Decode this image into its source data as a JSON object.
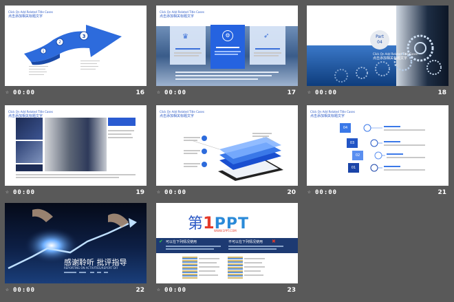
{
  "slides": [
    {
      "number": "16",
      "time": "00:00",
      "header_en": "Click On Add Related Title Cases",
      "header_cn": "点击添加相关标题文字",
      "circles": [
        "1",
        "2",
        "3"
      ]
    },
    {
      "number": "17",
      "time": "00:00",
      "header_en": "Click On Add Related Title Cases",
      "header_cn": "点击添加相关标题文字"
    },
    {
      "number": "18",
      "time": "00:00",
      "part_label": "Part",
      "part_num": "04",
      "header_en": "Click On Add Related Title Cases",
      "header_cn": "点击添加相关标题文字"
    },
    {
      "number": "19",
      "time": "00:00",
      "header_en": "Click On Add Related Title Cases",
      "header_cn": "点击添加相关标题文字"
    },
    {
      "number": "20",
      "time": "00:00",
      "header_en": "Click On Add Related Title Cases",
      "header_cn": "点击添加相关标题文字"
    },
    {
      "number": "21",
      "time": "00:00",
      "header_en": "Click On Add Related Title Cases",
      "header_cn": "点击添加相关标题文字",
      "steps": [
        "04",
        "03",
        "02",
        "01"
      ]
    },
    {
      "number": "22",
      "time": "00:00",
      "title": "感谢聆听 批评指导",
      "subtitle": "REPORTING ON ACTIVITIES/REPORT DIT"
    },
    {
      "number": "23",
      "time": "00:00",
      "logo_left": "第",
      "logo_num": "1",
      "logo_right": "PPT",
      "logo_sub": "WWW.1PPT.COM",
      "bar_left": "可以在下列情况使用",
      "bar_right": "不可以在下列情况使用"
    }
  ]
}
